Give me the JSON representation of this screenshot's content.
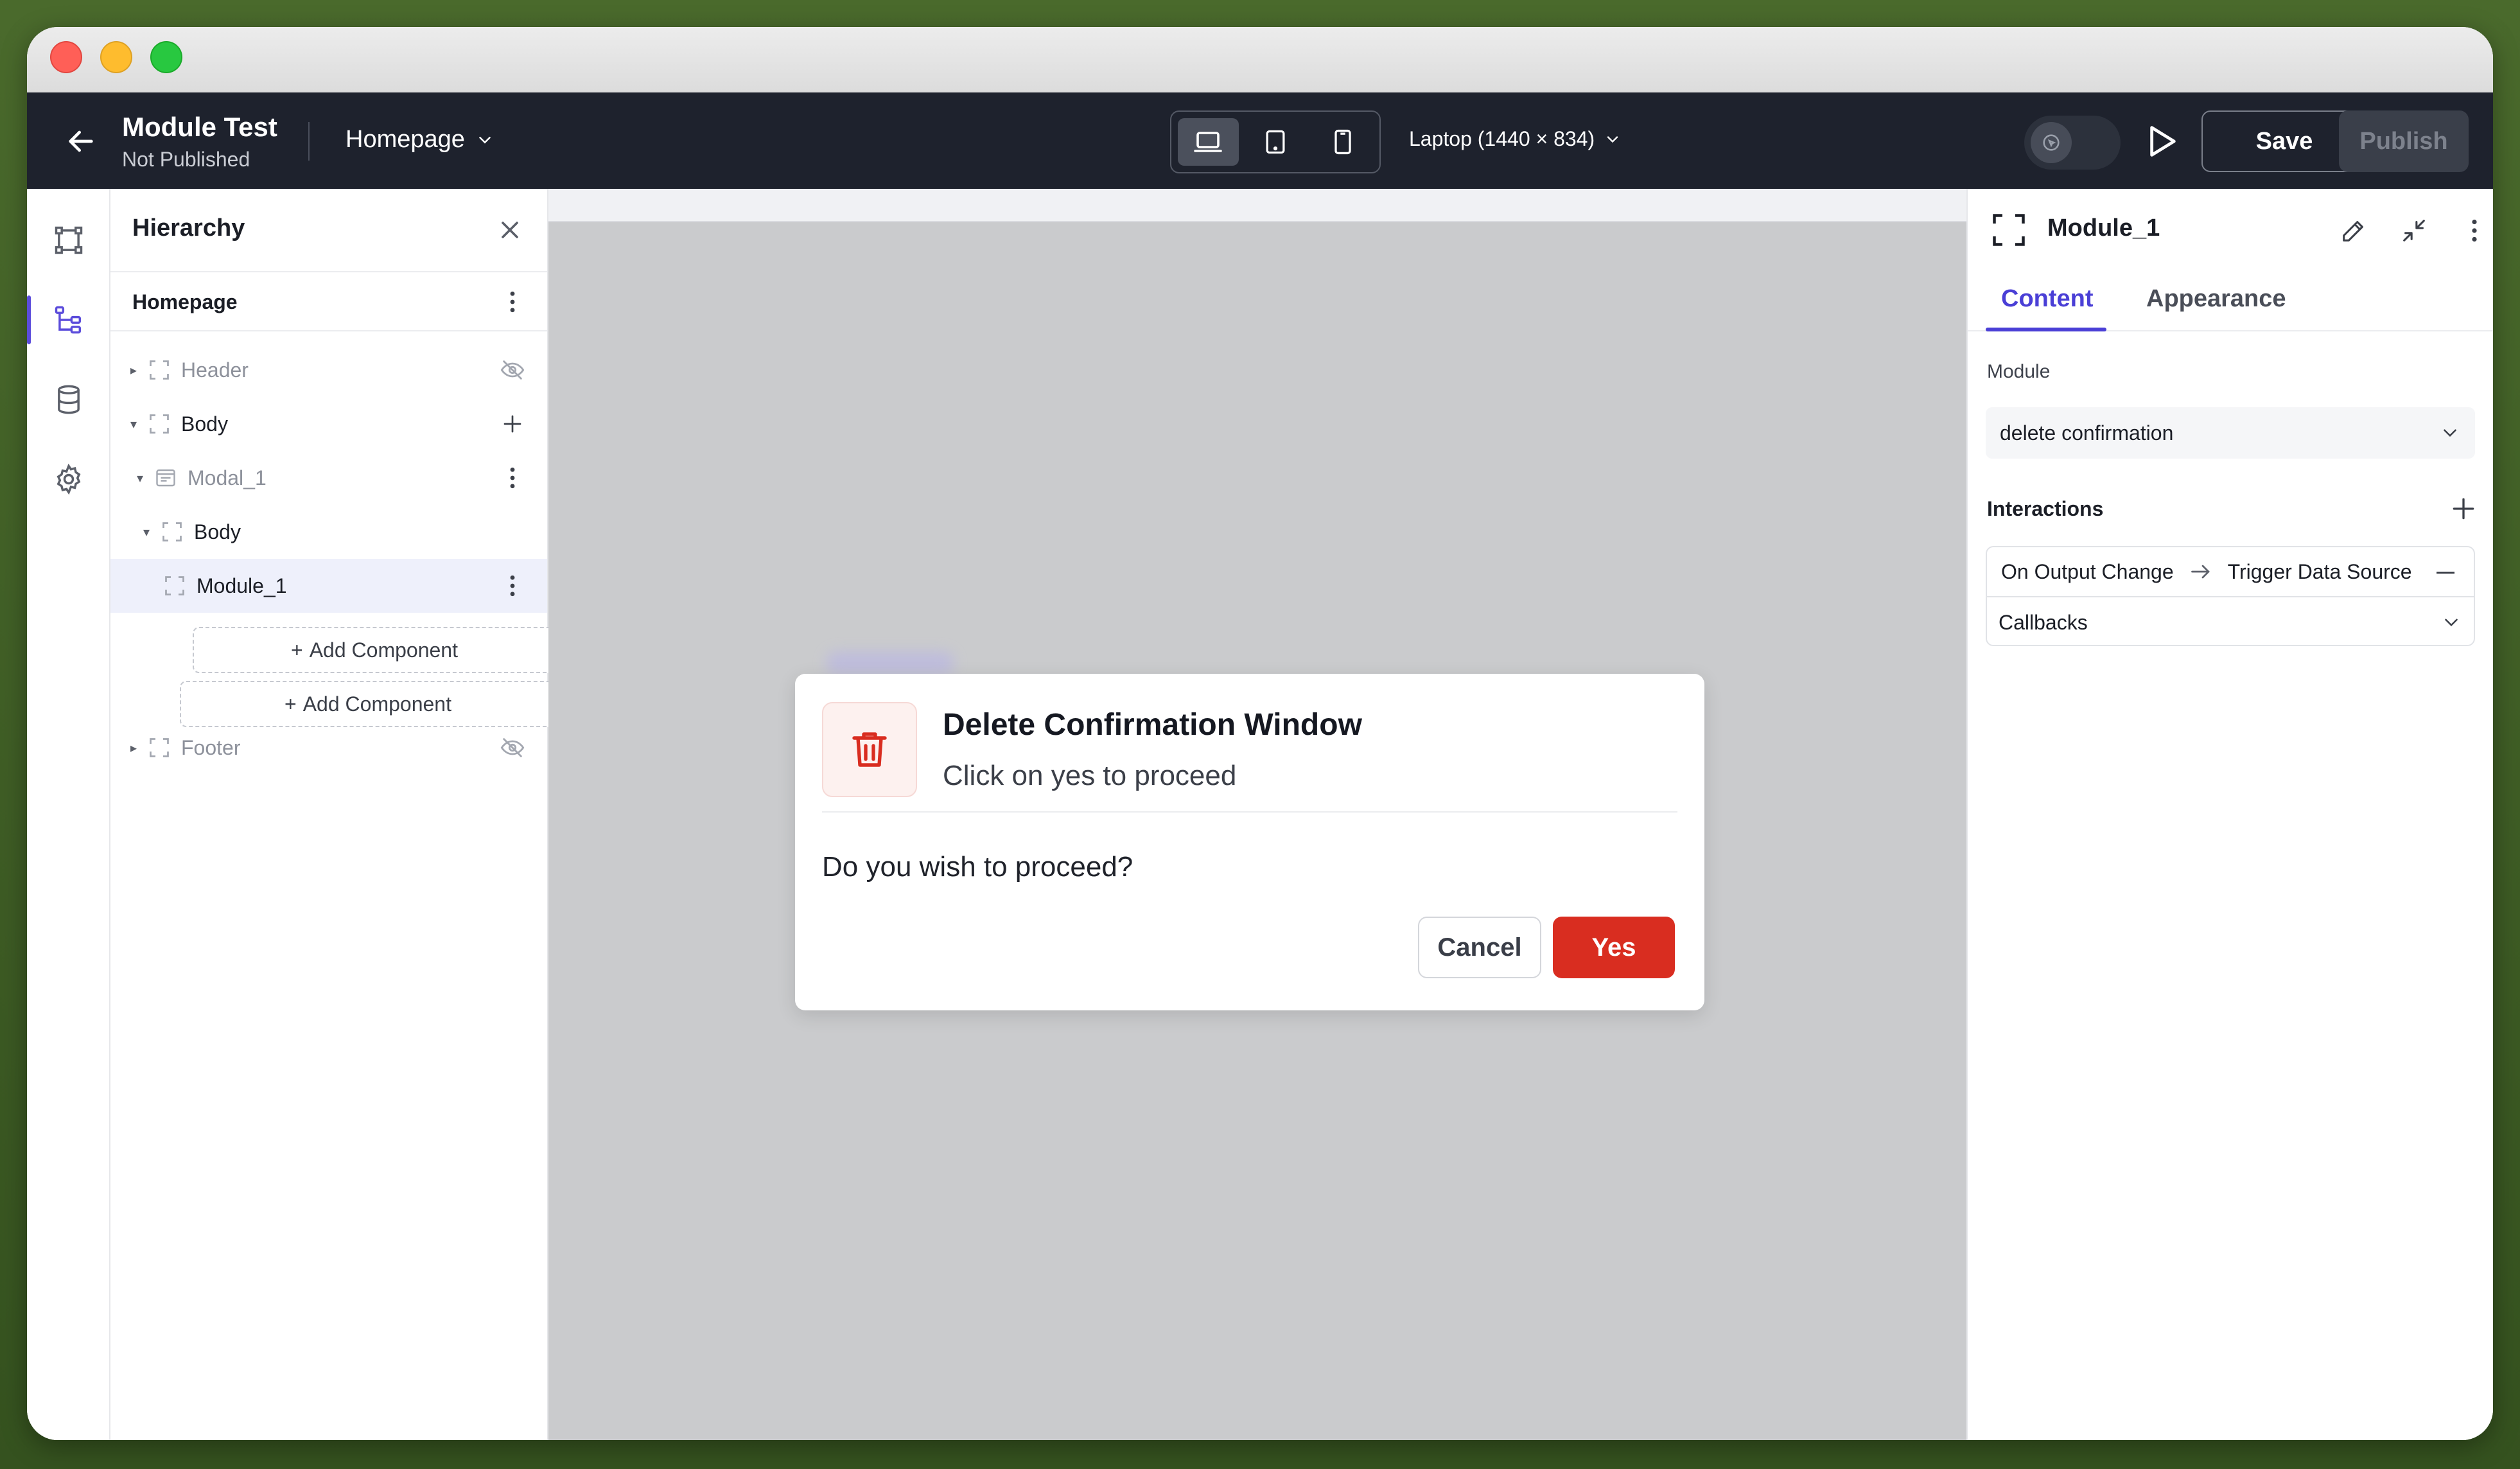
{
  "header": {
    "project_title": "Module Test",
    "project_status": "Not Published",
    "page_select": "Homepage",
    "viewport": "Laptop (1440 × 834)",
    "save_label": "Save",
    "publish_label": "Publish"
  },
  "rail": {
    "items": [
      "frame-icon",
      "hierarchy-icon",
      "database-icon",
      "gear-icon"
    ],
    "active_index": 1
  },
  "hierarchy": {
    "title": "Hierarchy",
    "page": "Homepage",
    "nodes": {
      "header": "Header",
      "body": "Body",
      "modal": "Modal_1",
      "modal_body": "Body",
      "module": "Module_1",
      "footer": "Footer"
    },
    "add_component": "Add Component"
  },
  "modal": {
    "title": "Delete Confirmation Window",
    "subtitle": "Click on yes to proceed",
    "body": "Do you wish to proceed?",
    "cancel_label": "Cancel",
    "confirm_label": "Yes"
  },
  "props": {
    "title": "Module_1",
    "tabs": [
      "Content",
      "Appearance"
    ],
    "active_tab": 0,
    "module_label": "Module",
    "module_value": "delete confirmation",
    "interactions_title": "Interactions",
    "interaction": {
      "event": "On Output Change",
      "action": "Trigger Data Source"
    },
    "callbacks_label": "Callbacks"
  },
  "colors": {
    "accent": "#4a3fd6",
    "danger": "#d92d20",
    "header_bg": "#1e222d"
  }
}
